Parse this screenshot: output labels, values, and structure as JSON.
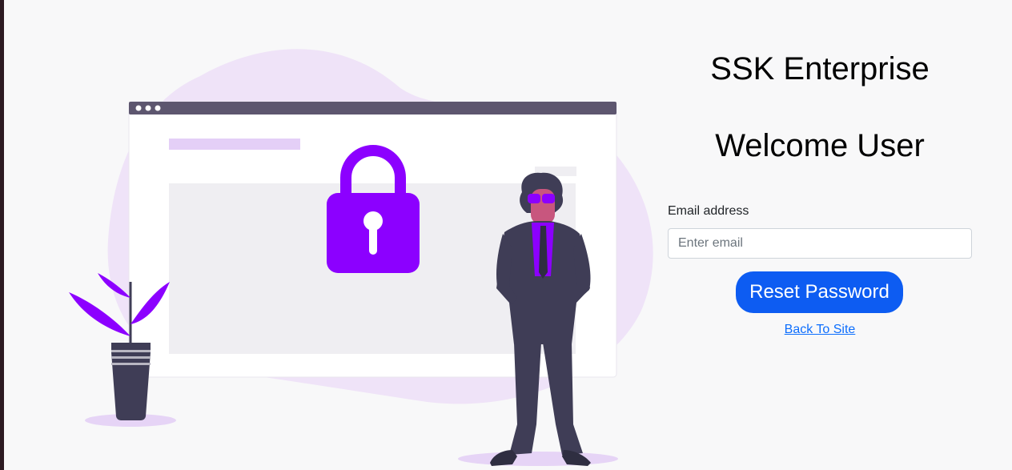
{
  "header": {
    "brand": "SSK Enterprise",
    "welcome": "Welcome User"
  },
  "form": {
    "email_label": "Email address",
    "email_placeholder": "Enter email",
    "email_value": "",
    "submit_label": "Reset Password",
    "back_link": "Back To Site"
  },
  "colors": {
    "accent": "#0d5cf2",
    "link": "#0d6efd",
    "illustration_purple": "#8c00ff",
    "blob": "#efe3f8",
    "figure_dark": "#3f3d56"
  },
  "illustration": {
    "icons": [
      "browser-window-icon",
      "padlock-icon",
      "person-figure",
      "potted-plant-icon"
    ]
  }
}
